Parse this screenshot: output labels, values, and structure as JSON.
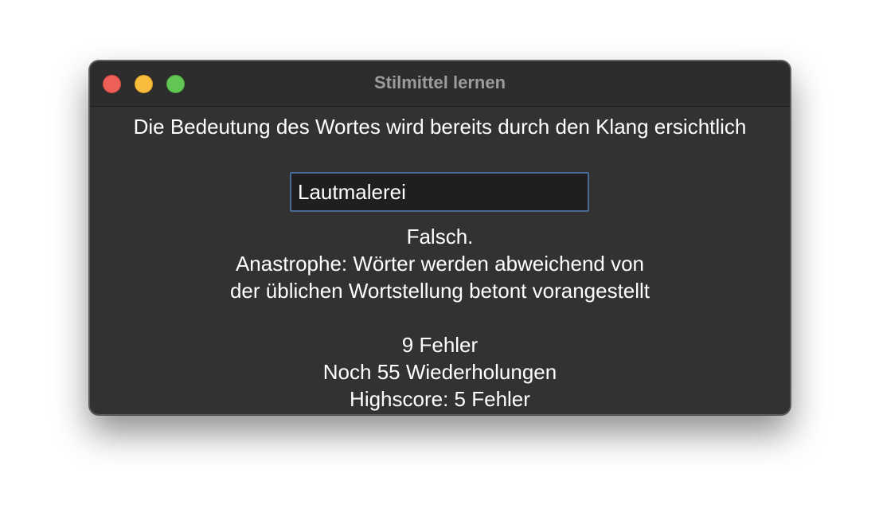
{
  "window": {
    "title": "Stilmittel lernen",
    "controls": {
      "close": "close-button",
      "minimize": "minimize-button",
      "zoom": "zoom-button"
    }
  },
  "quiz": {
    "prompt": "Die Bedeutung des Wortes wird bereits durch den Klang ersichtlich",
    "answer_value": "Lautmalerei",
    "result": "Falsch.",
    "correction_line1": "Anastrophe: Wörter werden abweichend von",
    "correction_line2": "der üblichen Wortstellung betont vorangestellt",
    "errors": "9 Fehler",
    "remaining": "Noch 55 Wiederholungen",
    "highscore": "Highscore: 5 Fehler"
  },
  "colors": {
    "window_bg": "#323232",
    "titlebar_bg": "#2d2d2d",
    "close": "#ee5f58",
    "minimize": "#f8bd3c",
    "zoom": "#62c654",
    "input_focus_border": "#4a6a96"
  }
}
